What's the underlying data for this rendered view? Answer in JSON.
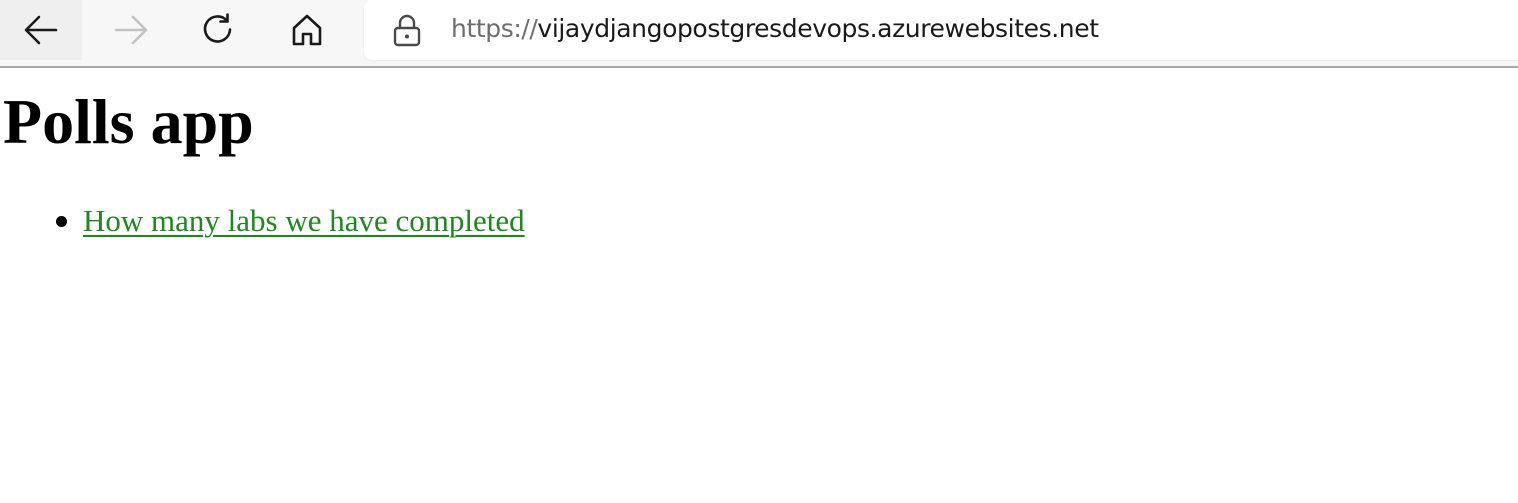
{
  "browser": {
    "toolbar": {
      "back_icon": "arrow-left-icon",
      "forward_icon": "arrow-right-icon",
      "refresh_icon": "refresh-icon",
      "home_icon": "home-icon",
      "forward_enabled": false
    },
    "address_bar": {
      "lock_icon": "lock-icon",
      "scheme": "https://",
      "host": "vijaydjangopostgresdevops.azurewebsites.net"
    }
  },
  "page": {
    "title": "Polls app",
    "polls": [
      {
        "question": "How many labs we have completed"
      }
    ]
  },
  "colors": {
    "link": "#1a8a1a",
    "toolbar_bg": "#f7f7f7",
    "toolbar_border": "#a6a6a6",
    "url_scheme": "#6e6e6e"
  }
}
